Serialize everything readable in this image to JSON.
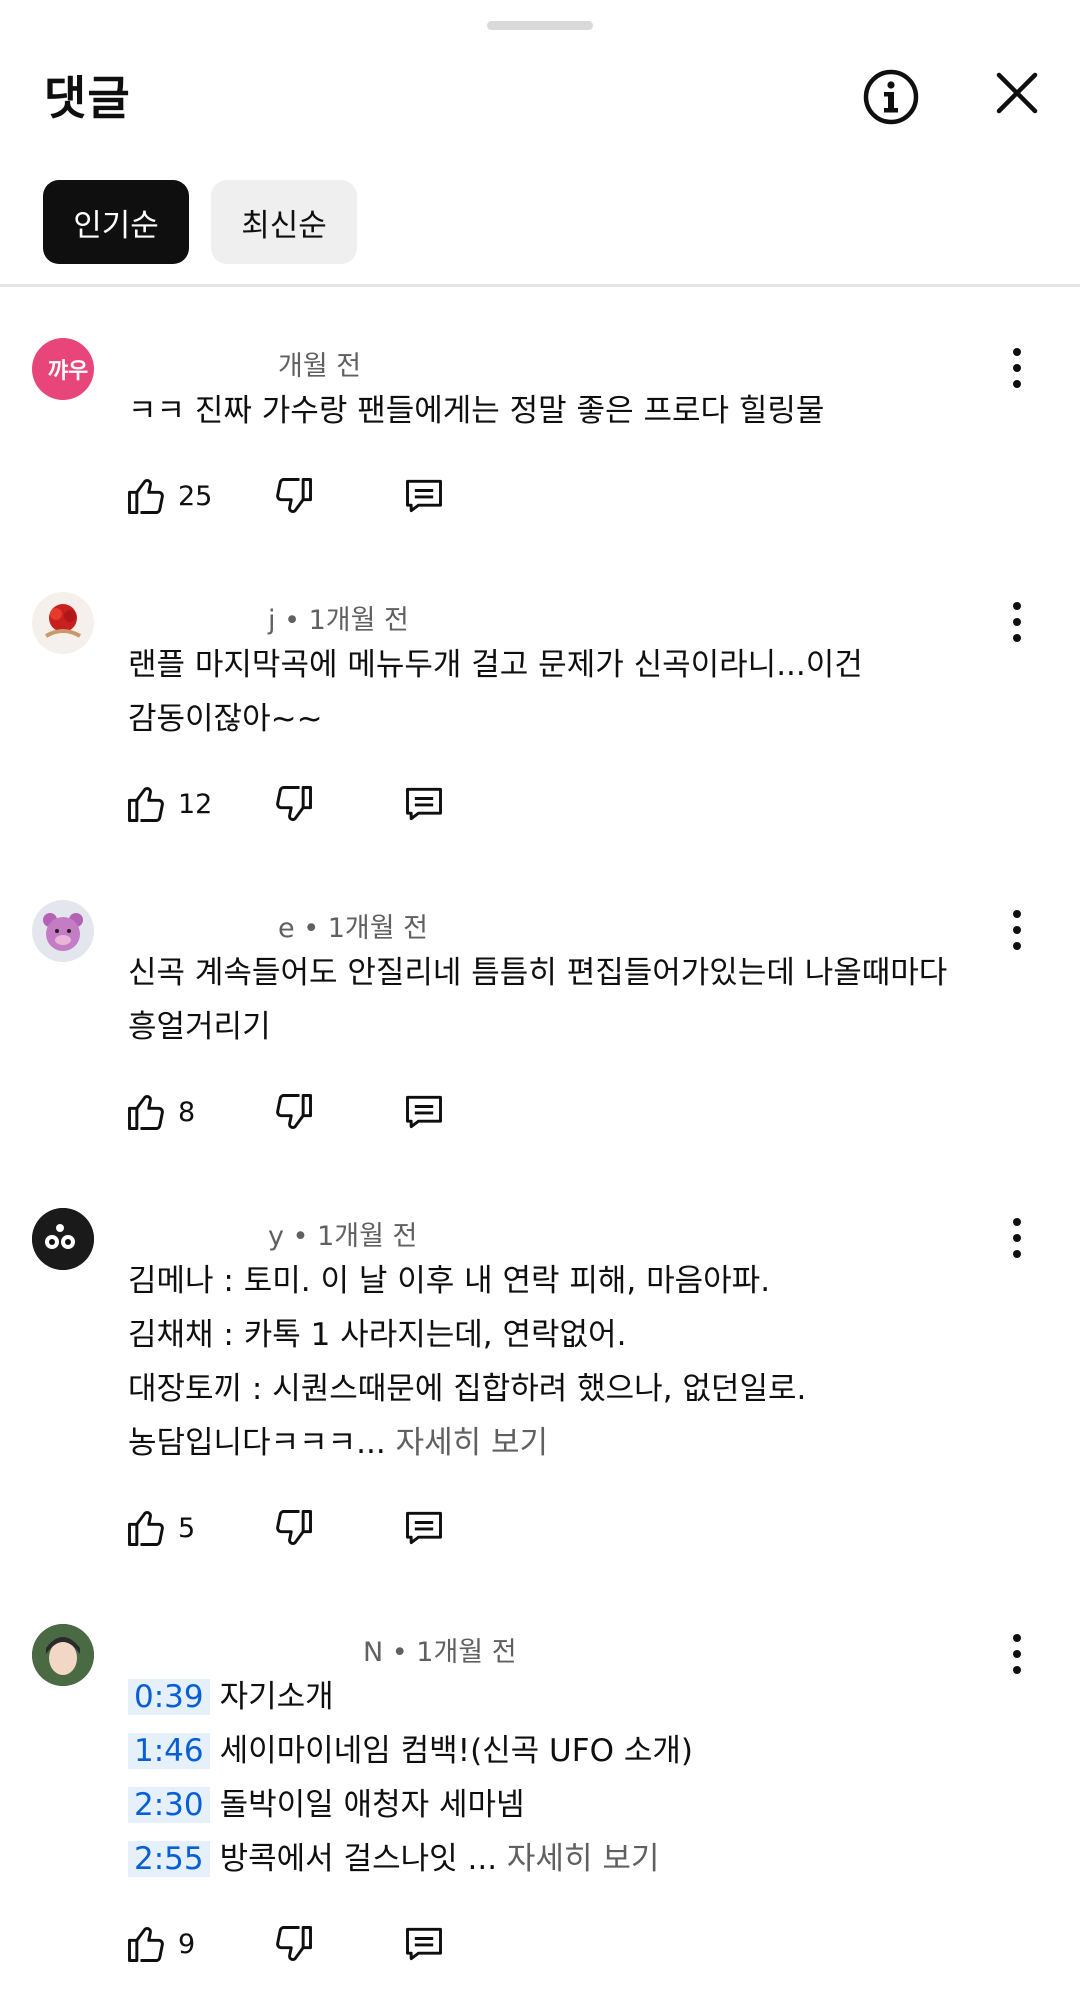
{
  "header": {
    "title": "댓글"
  },
  "chips": {
    "popular": "인기순",
    "newest": "최신순"
  },
  "comments": [
    {
      "avatar_text": "꺄우",
      "avatar_color": "#e8457a",
      "meta_prefix": "",
      "meta_suffix": "개월 전",
      "lines": [
        "ㅋㅋ 진짜 가수랑 팬들에게는 정말 좋은 프로다 힐링물"
      ],
      "more": "",
      "likes": "25"
    },
    {
      "avatar_text": "",
      "avatar_color": "#f3f3f3",
      "meta_prefix": "",
      "meta_suffix": "j • 1개월 전",
      "lines": [
        "랜플 마지막곡에 메뉴두개 걸고  문제가 신곡이라니...이건",
        "감동이잖아~~"
      ],
      "more": "",
      "likes": "12"
    },
    {
      "avatar_text": "",
      "avatar_color": "#e8eaf0",
      "meta_prefix": "",
      "meta_suffix": "e • 1개월 전",
      "lines": [
        "신곡 계속들어도 안질리네 틈틈히 편집들어가있는데 나올때마다",
        "흥얼거리기"
      ],
      "more": "",
      "likes": "8"
    },
    {
      "avatar_text": "",
      "avatar_color": "#1a1a1a",
      "meta_prefix": "",
      "meta_suffix": "y • 1개월 전",
      "lines": [
        "김메나 : 토미. 이 날 이후 내 연락 피해, 마음아파.",
        "김채채 : 카톡 1 사라지는데, 연락없어.",
        "대장토끼 : 시퀀스때문에 집합하려 했으나, 없던일로.",
        "농담입니다ㅋㅋㅋ..."
      ],
      "more": " 자세히 보기",
      "likes": "5"
    },
    {
      "avatar_text": "",
      "avatar_color": "#3d5a3a",
      "meta_prefix": "",
      "meta_suffix": "N • 1개월 전",
      "timestamps": [
        {
          "time": "0:39",
          "text": "자기소개"
        },
        {
          "time": "1:46",
          "text": "세이마이네임 컴백!(신곡 UFO 소개)"
        },
        {
          "time": "2:30",
          "text": "돌박이일 애청자 세마넴"
        },
        {
          "time": "2:55",
          "text": "방콕에서 걸스나잇 ..."
        }
      ],
      "more": " 자세히 보기",
      "likes": "9"
    }
  ]
}
